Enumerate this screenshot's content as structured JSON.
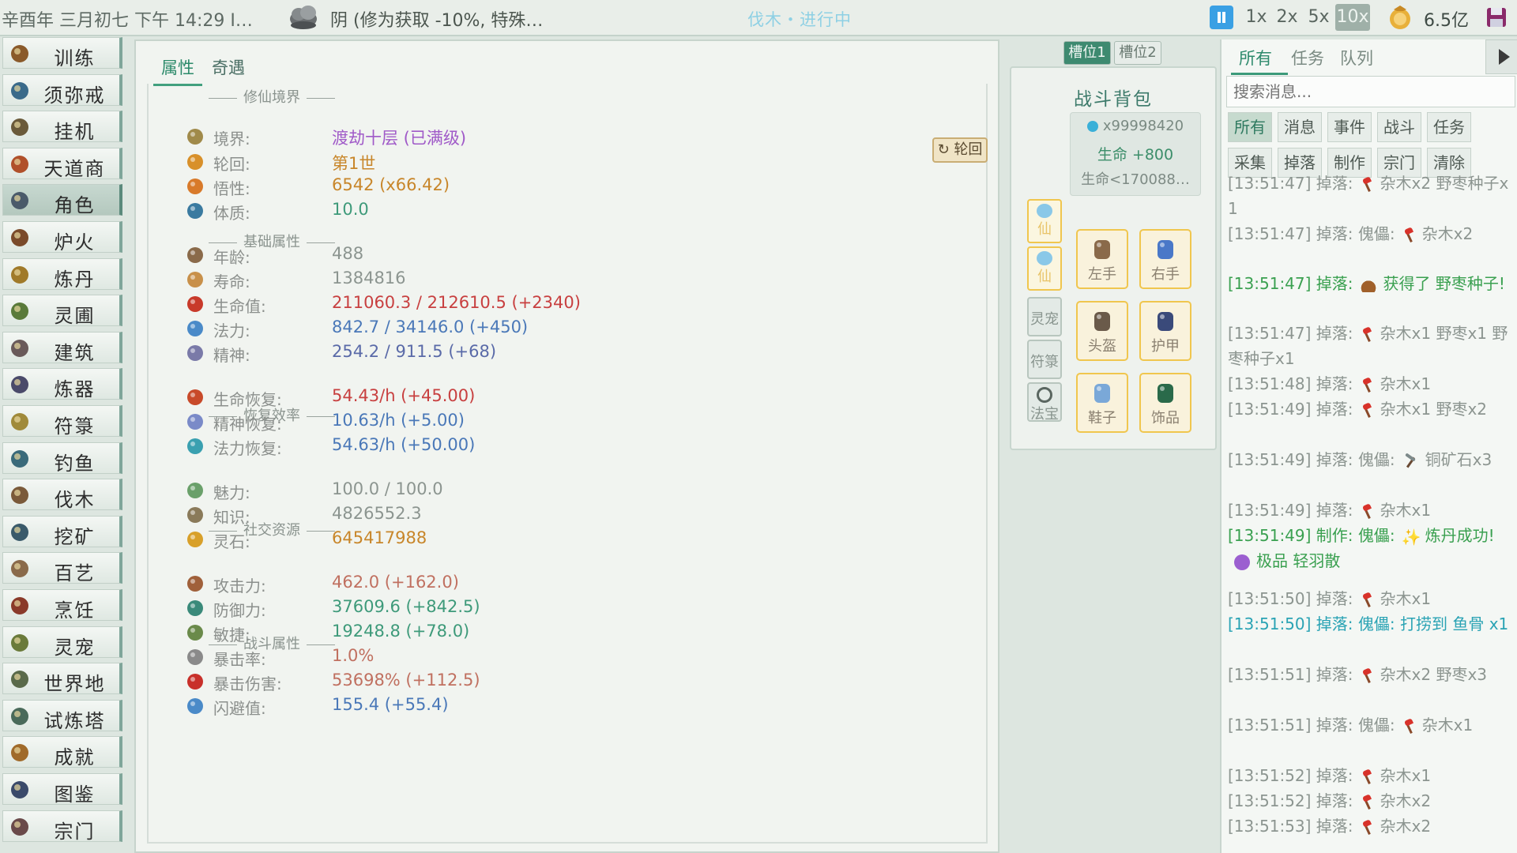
{
  "topbar": {
    "datetime": "辛酉年 三月初七 下午 14:29 I…",
    "weather": "阴 (修为获取 -10%, 特殊…",
    "activity": "伐木・进行中",
    "speeds": [
      "1x",
      "2x",
      "5x",
      "10x"
    ],
    "active_speed": "10x",
    "currency": "6.5亿"
  },
  "sidebar": {
    "items": [
      {
        "label": "训练",
        "icon": "training-icon"
      },
      {
        "label": "须弥戒",
        "icon": "ring-icon"
      },
      {
        "label": "挂机",
        "icon": "idle-icon"
      },
      {
        "label": "天道商店",
        "icon": "shop-icon"
      },
      {
        "label": "角色",
        "icon": "character-icon"
      },
      {
        "label": "炉火",
        "icon": "furnace-icon"
      },
      {
        "label": "炼丹",
        "icon": "alchemy-icon"
      },
      {
        "label": "灵圃",
        "icon": "garden-icon"
      },
      {
        "label": "建筑",
        "icon": "building-icon"
      },
      {
        "label": "炼器",
        "icon": "forge-icon"
      },
      {
        "label": "符箓",
        "icon": "talisman-icon"
      },
      {
        "label": "钓鱼",
        "icon": "fishing-icon"
      },
      {
        "label": "伐木",
        "icon": "logging-icon"
      },
      {
        "label": "挖矿",
        "icon": "mining-icon"
      },
      {
        "label": "百艺",
        "icon": "crafts-icon"
      },
      {
        "label": "烹饪",
        "icon": "cooking-icon"
      },
      {
        "label": "灵宠",
        "icon": "pet-icon"
      },
      {
        "label": "世界地图",
        "icon": "map-icon"
      },
      {
        "label": "试炼塔",
        "icon": "tower-icon"
      },
      {
        "label": "成就",
        "icon": "achievement-icon"
      },
      {
        "label": "图鉴",
        "icon": "codex-icon"
      },
      {
        "label": "宗门",
        "icon": "sect-icon"
      }
    ],
    "active": "角色"
  },
  "main": {
    "tabs": [
      "属性",
      "奇遇"
    ],
    "active_tab": "属性",
    "rebirth_button": "↻ 轮回",
    "sections": {
      "cultivation": "修仙境界",
      "base": "基础属性",
      "recovery": "恢复效率",
      "social": "社交资源",
      "combat": "战斗属性"
    },
    "rows": [
      {
        "label": "境界:",
        "value": "渡劫十层 (已满级)",
        "color": "#a05ac8"
      },
      {
        "label": "轮回:",
        "value": "第1世",
        "color": "#c8862a"
      },
      {
        "label": "悟性:",
        "value": "6542 (x66.42)",
        "color": "#c8862a"
      },
      {
        "label": "体质:",
        "value": "10.0",
        "color": "#3e9a7a"
      },
      {
        "label": "年龄:",
        "value": "488",
        "color": "#8c9590"
      },
      {
        "label": "寿命:",
        "value": "1384816",
        "color": "#8c9590"
      },
      {
        "label": "生命值:",
        "value": "211060.3 / 212610.5 (+2340)",
        "color": "#c84040"
      },
      {
        "label": "法力:",
        "value": "842.7 / 34146.0 (+450)",
        "color": "#4a78b8"
      },
      {
        "label": "精神:",
        "value": "254.2 / 911.5 (+68)",
        "color": "#5a6aa8"
      },
      {
        "label": "生命恢复:",
        "value": "54.43/h (+45.00)",
        "color": "#c84040"
      },
      {
        "label": "精神恢复:",
        "value": "10.63/h (+5.00)",
        "color": "#4a78b8"
      },
      {
        "label": "法力恢复:",
        "value": "54.63/h (+50.00)",
        "color": "#4a78b8"
      },
      {
        "label": "魅力:",
        "value": "100.0 / 100.0",
        "color": "#8c9590"
      },
      {
        "label": "知识:",
        "value": "4826552.3",
        "color": "#8c9590"
      },
      {
        "label": "灵石:",
        "value": "645417988",
        "color": "#c8862a"
      },
      {
        "label": "攻击力:",
        "value": "462.0 (+162.0)",
        "color": "#c07060"
      },
      {
        "label": "防御力:",
        "value": "37609.6 (+842.5)",
        "color": "#3e9a7a"
      },
      {
        "label": "敏捷:",
        "value": "19248.8 (+78.0)",
        "color": "#3e9a7a"
      },
      {
        "label": "暴击率:",
        "value": "1.0%",
        "color": "#c07060"
      },
      {
        "label": "暴击伤害:",
        "value": "53698% (+112.5)",
        "color": "#c07060"
      },
      {
        "label": "闪避值:",
        "value": "155.4 (+55.4)",
        "color": "#4a78b8"
      }
    ]
  },
  "bag": {
    "slot_tabs": [
      "槽位1",
      "槽位2"
    ],
    "active_slot": "槽位1",
    "title": "战斗背包",
    "gem_count": "x99998420",
    "hp_bonus": "生命 +800",
    "hp_limit": "生命<170088…",
    "side_slots": [
      {
        "label": "仙",
        "style": "gold"
      },
      {
        "label": "仙",
        "style": "gold"
      },
      {
        "label": "灵宠",
        "style": "plain"
      },
      {
        "label": "符箓",
        "style": "plain"
      },
      {
        "label": "法宝",
        "style": "plain"
      }
    ],
    "equipment": [
      "左手",
      "右手",
      "头盔",
      "护甲",
      "鞋子",
      "饰品"
    ]
  },
  "log": {
    "tabs": [
      "所有",
      "任务",
      "队列"
    ],
    "active_tab": "所有",
    "search_placeholder": "搜索消息...",
    "filters": [
      "所有",
      "消息",
      "事件",
      "战斗",
      "任务",
      "采集",
      "掉落",
      "制作",
      "宗门",
      "清除"
    ],
    "active_filter": "所有",
    "entries": [
      {
        "pre": "[13:51:47] 掉落:",
        "icon": "axe",
        "post": "杂木x2 野枣种子x1",
        "style": "gray"
      },
      {
        "pre": "[13:51:47] 掉落: 傀儡:",
        "icon": "axe",
        "post": "杂木x2",
        "style": "gray"
      },
      {
        "pre": "[13:51:47] 掉落:",
        "icon": "seed",
        "post": "获得了 野枣种子!",
        "style": "green"
      },
      {
        "pre": "[13:51:47] 掉落:",
        "icon": "axe",
        "post": "杂木x1 野枣x1 野枣种子x1",
        "style": "gray"
      },
      {
        "pre": "[13:51:48] 掉落:",
        "icon": "axe",
        "post": "杂木x1",
        "style": "gray"
      },
      {
        "pre": "[13:51:49] 掉落:",
        "icon": "axe",
        "post": "杂木x1 野枣x2",
        "style": "gray"
      },
      {
        "pre": "[13:51:49] 掉落: 傀儡:",
        "icon": "pick",
        "post": "铜矿石x3",
        "style": "gray"
      },
      {
        "pre": "[13:51:49] 掉落:",
        "icon": "axe",
        "post": "杂木x1",
        "style": "gray"
      },
      {
        "pre": "[13:51:49] 制作: 傀儡:",
        "icon": "spark",
        "post": "炼丹成功!",
        "icon2": "dot",
        "post2": "极品 轻羽散",
        "style": "green"
      },
      {
        "pre": "[13:51:50] 掉落:",
        "icon": "axe",
        "post": "杂木x1",
        "style": "gray"
      },
      {
        "pre": "[13:51:50] 掉落: 傀儡: 打捞到 鱼骨 x1",
        "icon": "",
        "post": "",
        "style": "cyan"
      },
      {
        "pre": "[13:51:51] 掉落:",
        "icon": "axe",
        "post": "杂木x2 野枣x3",
        "style": "gray"
      },
      {
        "pre": "[13:51:51] 掉落: 傀儡:",
        "icon": "axe",
        "post": "杂木x1",
        "style": "gray"
      },
      {
        "pre": "[13:51:52] 掉落:",
        "icon": "axe",
        "post": "杂木x1",
        "style": "gray"
      },
      {
        "pre": "[13:51:52] 掉落:",
        "icon": "axe",
        "post": "杂木x2",
        "style": "gray"
      },
      {
        "pre": "[13:51:53] 掉落:",
        "icon": "axe",
        "post": "杂木x2",
        "style": "gray"
      }
    ]
  }
}
